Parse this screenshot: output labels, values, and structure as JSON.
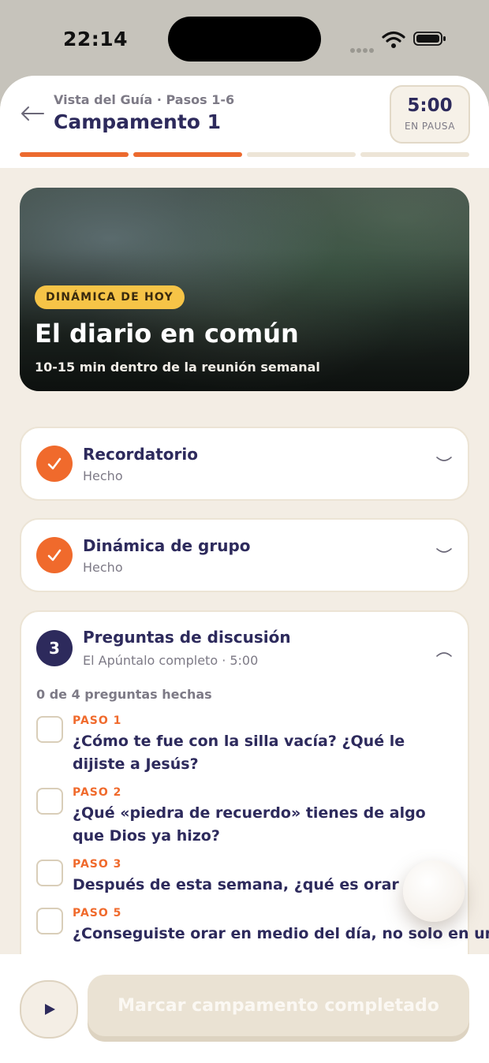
{
  "status_bar": {
    "time": "22:14"
  },
  "header": {
    "subtitle": "Vista del Guía · Pasos 1-6",
    "title": "Campamento 1",
    "timer": {
      "value": "5:00",
      "status": "EN PAUSA"
    },
    "progress": {
      "segments_total": 4,
      "segments_done": 2
    }
  },
  "hero": {
    "badge": "DINÁMICA DE HOY",
    "title": "El diario en común",
    "subtitle": "10-15 min dentro de la reunión semanal"
  },
  "sections": [
    {
      "title": "Recordatorio",
      "status": "Hecho",
      "done": true
    },
    {
      "title": "Dinámica de grupo",
      "status": "Hecho",
      "done": true
    },
    {
      "number": "3",
      "title": "Preguntas de discusión",
      "meta": "El Apúntalo completo · 5:00",
      "progress_text": "0 de 4 preguntas hechas",
      "questions": [
        {
          "step": "PASO 1",
          "text": "¿Cómo te fue con la silla vacía? ¿Qué le dijiste a Jesús?"
        },
        {
          "step": "PASO 2",
          "text": "¿Qué «piedra de recuerdo» tienes de algo que Dios ya hizo?"
        },
        {
          "step": "PASO 3",
          "text": "Después de esta semana, ¿qué es orar para ti"
        },
        {
          "step": "PASO 5",
          "text": "¿Conseguiste orar en medio del día, no solo en un"
        }
      ]
    }
  ],
  "bottom": {
    "complete_label": "Marcar campamento completado"
  },
  "colors": {
    "accent": "#f06a2c",
    "navy": "#2d2a5c",
    "badge": "#f6c447",
    "background": "#f3ede4"
  }
}
